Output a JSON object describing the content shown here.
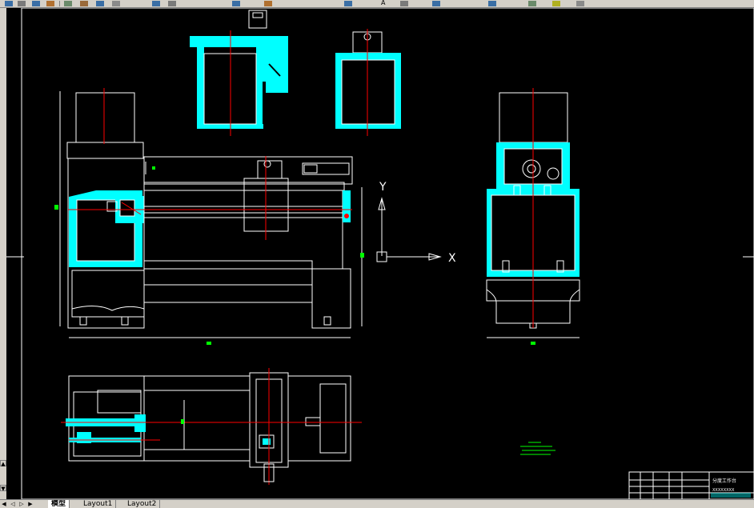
{
  "toolbar": {
    "icons": [
      "pan-icon",
      "zoom-icon",
      "undo-icon",
      "redo-icon",
      "layer-icon",
      "properties-icon",
      "text-style-icon",
      "dim-style-icon",
      "table-icon",
      "grid-icon",
      "save-icon",
      "color-icon",
      "linetype-icon",
      "lineweight-icon"
    ],
    "text_glyph": "A"
  },
  "drawing": {
    "axis_y_label": "Y",
    "axis_x_label": "X",
    "title_block_heading": "分度工作台",
    "title_block_subtitle": "XXXXXXXX",
    "colors": {
      "cyan": "#00ffff",
      "white": "#ffffff",
      "red": "#ff0000",
      "green": "#00ff00"
    }
  },
  "tabs": {
    "items": [
      "模型",
      "Layout1",
      "Layout2"
    ],
    "active": 0
  }
}
